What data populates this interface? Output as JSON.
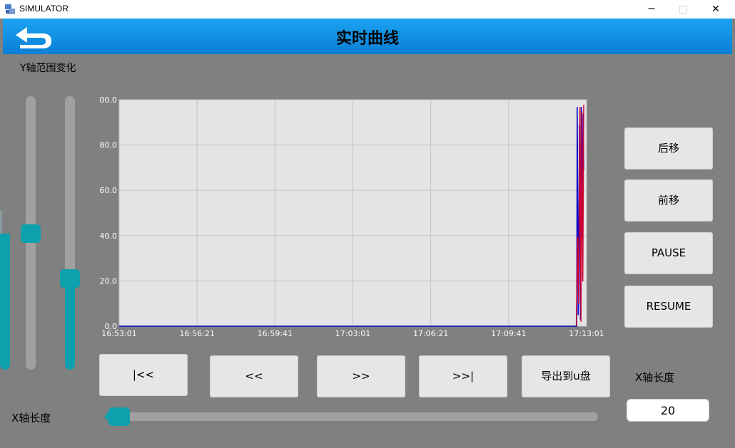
{
  "window": {
    "title": "SIMULATOR",
    "minimize": "─",
    "maximize": "□",
    "close": "✕"
  },
  "header": {
    "title": "实时曲线",
    "back_icon": "back-arrow-icon"
  },
  "y_range": {
    "label": "Y轴范围变化",
    "slider_max_level": 0.5,
    "slider_min_level": 0.35
  },
  "buttons": {
    "move_back": "后移",
    "move_forward": "前移",
    "pause": "PAUSE",
    "resume": "RESUME",
    "first": "|<<",
    "prev": "<<",
    "next": ">>",
    "last": ">>|",
    "export": "导出到u盘"
  },
  "x_length": {
    "label_right": "X轴长度",
    "label_bottom": "X轴长度",
    "value": "20",
    "slider_level": 0.02
  },
  "colors": {
    "accent": "#0fa0ad",
    "header": "#1496e6",
    "series_blue": "#0000cc",
    "series_red": "#cc0033"
  },
  "chart_data": {
    "type": "line",
    "x_ticks": [
      "16:53:01",
      "16:56:21",
      "16:59:41",
      "17:03:01",
      "17:06:21",
      "17:09:41",
      "17:13:01"
    ],
    "y_ticks": [
      "0.0",
      "20.0",
      "40.0",
      "60.0",
      "80.0",
      "00.0"
    ],
    "ylim": [
      0,
      100
    ],
    "grid": true,
    "series": [
      {
        "color": "#0000cc",
        "points": [
          [
            0,
            0
          ],
          [
            0.985,
            0
          ],
          [
            0.986,
            98
          ],
          [
            0.988,
            5
          ],
          [
            0.991,
            90
          ],
          [
            0.993,
            3
          ],
          [
            0.995,
            98
          ],
          [
            0.997,
            40
          ],
          [
            0.999,
            95
          ],
          [
            1.0,
            70
          ]
        ]
      },
      {
        "color": "#cc0033",
        "points": [
          [
            0.984,
            0
          ],
          [
            0.987,
            40
          ],
          [
            0.989,
            10
          ],
          [
            0.992,
            98
          ],
          [
            0.994,
            2
          ],
          [
            0.996,
            96
          ],
          [
            0.998,
            20
          ],
          [
            1.0,
            99
          ]
        ]
      }
    ]
  }
}
